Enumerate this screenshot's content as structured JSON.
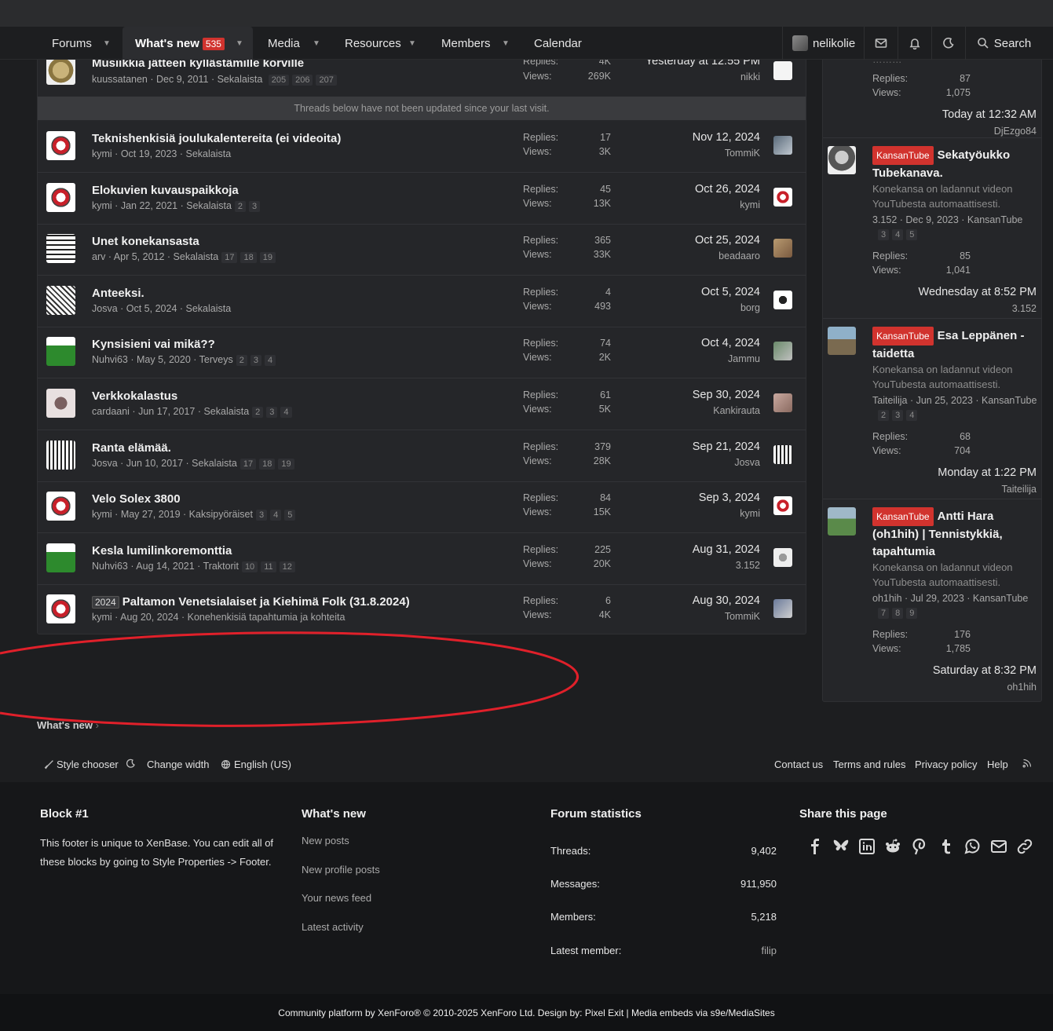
{
  "nav": {
    "forums": "Forums",
    "whats_new": "What's new",
    "whats_new_count": "535",
    "media": "Media",
    "resources": "Resources",
    "members": "Members",
    "calendar": "Calendar",
    "username": "nelikolie",
    "search": "Search"
  },
  "threads": {
    "notice": "Threads below have not been updated since your last visit.",
    "replies_label": "Replies:",
    "views_label": "Views:",
    "top": {
      "title": "Musiikkia jätteen kyllästämille korville",
      "author": "kuussatanen",
      "started": "Dec 9, 2011",
      "forum": "Sekalaista",
      "pages": [
        "205",
        "206",
        "207"
      ],
      "replies": "4K",
      "views": "269K",
      "last_date": "Yesterday at 12:55 PM",
      "last_user": "nikki"
    },
    "rows": [
      {
        "title": "Teknishenkisiä joulukalentereita (ei videoita)",
        "author": "kymi",
        "started": "Oct 19, 2023",
        "forum": "Sekalaista",
        "pages": [],
        "replies": "17",
        "views": "3K",
        "last_date": "Nov 12, 2024",
        "last_user": "TommiK"
      },
      {
        "title": "Elokuvien kuvauspaikkoja",
        "author": "kymi",
        "started": "Jan 22, 2021",
        "forum": "Sekalaista",
        "pages": [
          "2",
          "3"
        ],
        "replies": "45",
        "views": "13K",
        "last_date": "Oct 26, 2024",
        "last_user": "kymi"
      },
      {
        "title": "Unet konekansasta",
        "author": "arv",
        "started": "Apr 5, 2012",
        "forum": "Sekalaista",
        "pages": [
          "17",
          "18",
          "19"
        ],
        "replies": "365",
        "views": "33K",
        "last_date": "Oct 25, 2024",
        "last_user": "beadaaro"
      },
      {
        "title": "Anteeksi.",
        "author": "Josva",
        "started": "Oct 5, 2024",
        "forum": "Sekalaista",
        "pages": [],
        "replies": "4",
        "views": "493",
        "last_date": "Oct 5, 2024",
        "last_user": "borg"
      },
      {
        "title": "Kynsisieni vai mikä??",
        "author": "Nuhvi63",
        "started": "May 5, 2020",
        "forum": "Terveys",
        "pages": [
          "2",
          "3",
          "4"
        ],
        "replies": "74",
        "views": "2K",
        "last_date": "Oct 4, 2024",
        "last_user": "Jammu"
      },
      {
        "title": "Verkkokalastus",
        "author": "cardaani",
        "started": "Jun 17, 2017",
        "forum": "Sekalaista",
        "pages": [
          "2",
          "3",
          "4"
        ],
        "replies": "61",
        "views": "5K",
        "last_date": "Sep 30, 2024",
        "last_user": "Kankirauta"
      },
      {
        "title": "Ranta elämää.",
        "author": "Josva",
        "started": "Jun 10, 2017",
        "forum": "Sekalaista",
        "pages": [
          "17",
          "18",
          "19"
        ],
        "replies": "379",
        "views": "28K",
        "last_date": "Sep 21, 2024",
        "last_user": "Josva"
      },
      {
        "title": "Velo Solex 3800",
        "author": "kymi",
        "started": "May 27, 2019",
        "forum": "Kaksipyöräiset",
        "pages": [
          "3",
          "4",
          "5"
        ],
        "replies": "84",
        "views": "15K",
        "last_date": "Sep 3, 2024",
        "last_user": "kymi"
      },
      {
        "title": "Kesla lumilinkoremonttia",
        "author": "Nuhvi63",
        "started": "Aug 14, 2021",
        "forum": "Traktorit",
        "pages": [
          "10",
          "11",
          "12"
        ],
        "replies": "225",
        "views": "20K",
        "last_date": "Aug 31, 2024",
        "last_user": "3.152"
      },
      {
        "prefix": "2024",
        "title": "Paltamon Venetsialaiset ja Kiehimä Folk (31.8.2024)",
        "author": "kymi",
        "started": "Aug 20, 2024",
        "forum": "Konehenkisiä tapahtumia ja kohteita",
        "pages": [],
        "replies": "6",
        "views": "4K",
        "last_date": "Aug 30, 2024",
        "last_user": "TommiK"
      }
    ]
  },
  "sidebar": {
    "replies_label": "Replies:",
    "views_label": "Views:",
    "first": {
      "replies": "87",
      "views": "1,075",
      "last_date": "Today at 12:32 AM",
      "last_user": "DjEzgo84"
    },
    "items": [
      {
        "tag": "KansanTube",
        "title": "Sekatyöukko Tubekanava.",
        "text": "Konekansa on ladannut videon YouTubesta automaattisesti.",
        "author": "3.152",
        "date": "Dec 9, 2023",
        "forum": "KansanTube",
        "pages": [
          "3",
          "4",
          "5"
        ],
        "replies": "85",
        "views": "1,041",
        "last_date": "Wednesday at 8:52 PM",
        "last_user": "3.152"
      },
      {
        "tag": "KansanTube",
        "title": "Esa Leppänen - taidetta",
        "text": "Konekansa on ladannut videon YouTubesta automaattisesti.",
        "author": "Taiteilija",
        "date": "Jun 25, 2023",
        "forum": "KansanTube",
        "pages": [
          "2",
          "3",
          "4"
        ],
        "replies": "68",
        "views": "704",
        "last_date": "Monday at 1:22 PM",
        "last_user": "Taiteilija"
      },
      {
        "tag": "KansanTube",
        "title": "Antti Hara (oh1hih) | Tennistykkiä, tapahtumia",
        "text": "Konekansa on ladannut videon YouTubesta automaattisesti.",
        "author": "oh1hih",
        "date": "Jul 29, 2023",
        "forum": "KansanTube",
        "pages": [
          "7",
          "8",
          "9"
        ],
        "replies": "176",
        "views": "1,785",
        "last_date": "Saturday at 8:32 PM",
        "last_user": "oh1hih"
      }
    ]
  },
  "breadcrumb": "What's new",
  "footer_links": {
    "style_chooser": "Style chooser",
    "change_width": "Change width",
    "language": "English (US)",
    "contact": "Contact us",
    "terms": "Terms and rules",
    "privacy": "Privacy policy",
    "help": "Help"
  },
  "footer": {
    "block1_title": "Block #1",
    "block1_text": "This footer is unique to XenBase. You can edit all of these blocks by going to Style Properties -> Footer.",
    "whats_new_title": "What's new",
    "whats_new_links": [
      "New posts",
      "New profile posts",
      "Your news feed",
      "Latest activity"
    ],
    "stats_title": "Forum statistics",
    "stats": [
      {
        "label": "Threads:",
        "value": "9,402"
      },
      {
        "label": "Messages:",
        "value": "911,950"
      },
      {
        "label": "Members:",
        "value": "5,218"
      },
      {
        "label": "Latest member:",
        "value": "filip"
      }
    ],
    "share_title": "Share this page",
    "share_icons": [
      "facebook-icon",
      "bluesky-icon",
      "linkedin-icon",
      "reddit-icon",
      "pinterest-icon",
      "tumblr-icon",
      "whatsapp-icon",
      "email-icon",
      "link-icon"
    ]
  },
  "copyright": "Community platform by XenForo® © 2010-2025 XenForo Ltd. Design by: Pixel Exit | Media embeds via s9e/MediaSites",
  "colors": {
    "accent": "#d1332e",
    "annotation": "#e0202a",
    "background": "#1d1e20",
    "panel": "#252629"
  }
}
